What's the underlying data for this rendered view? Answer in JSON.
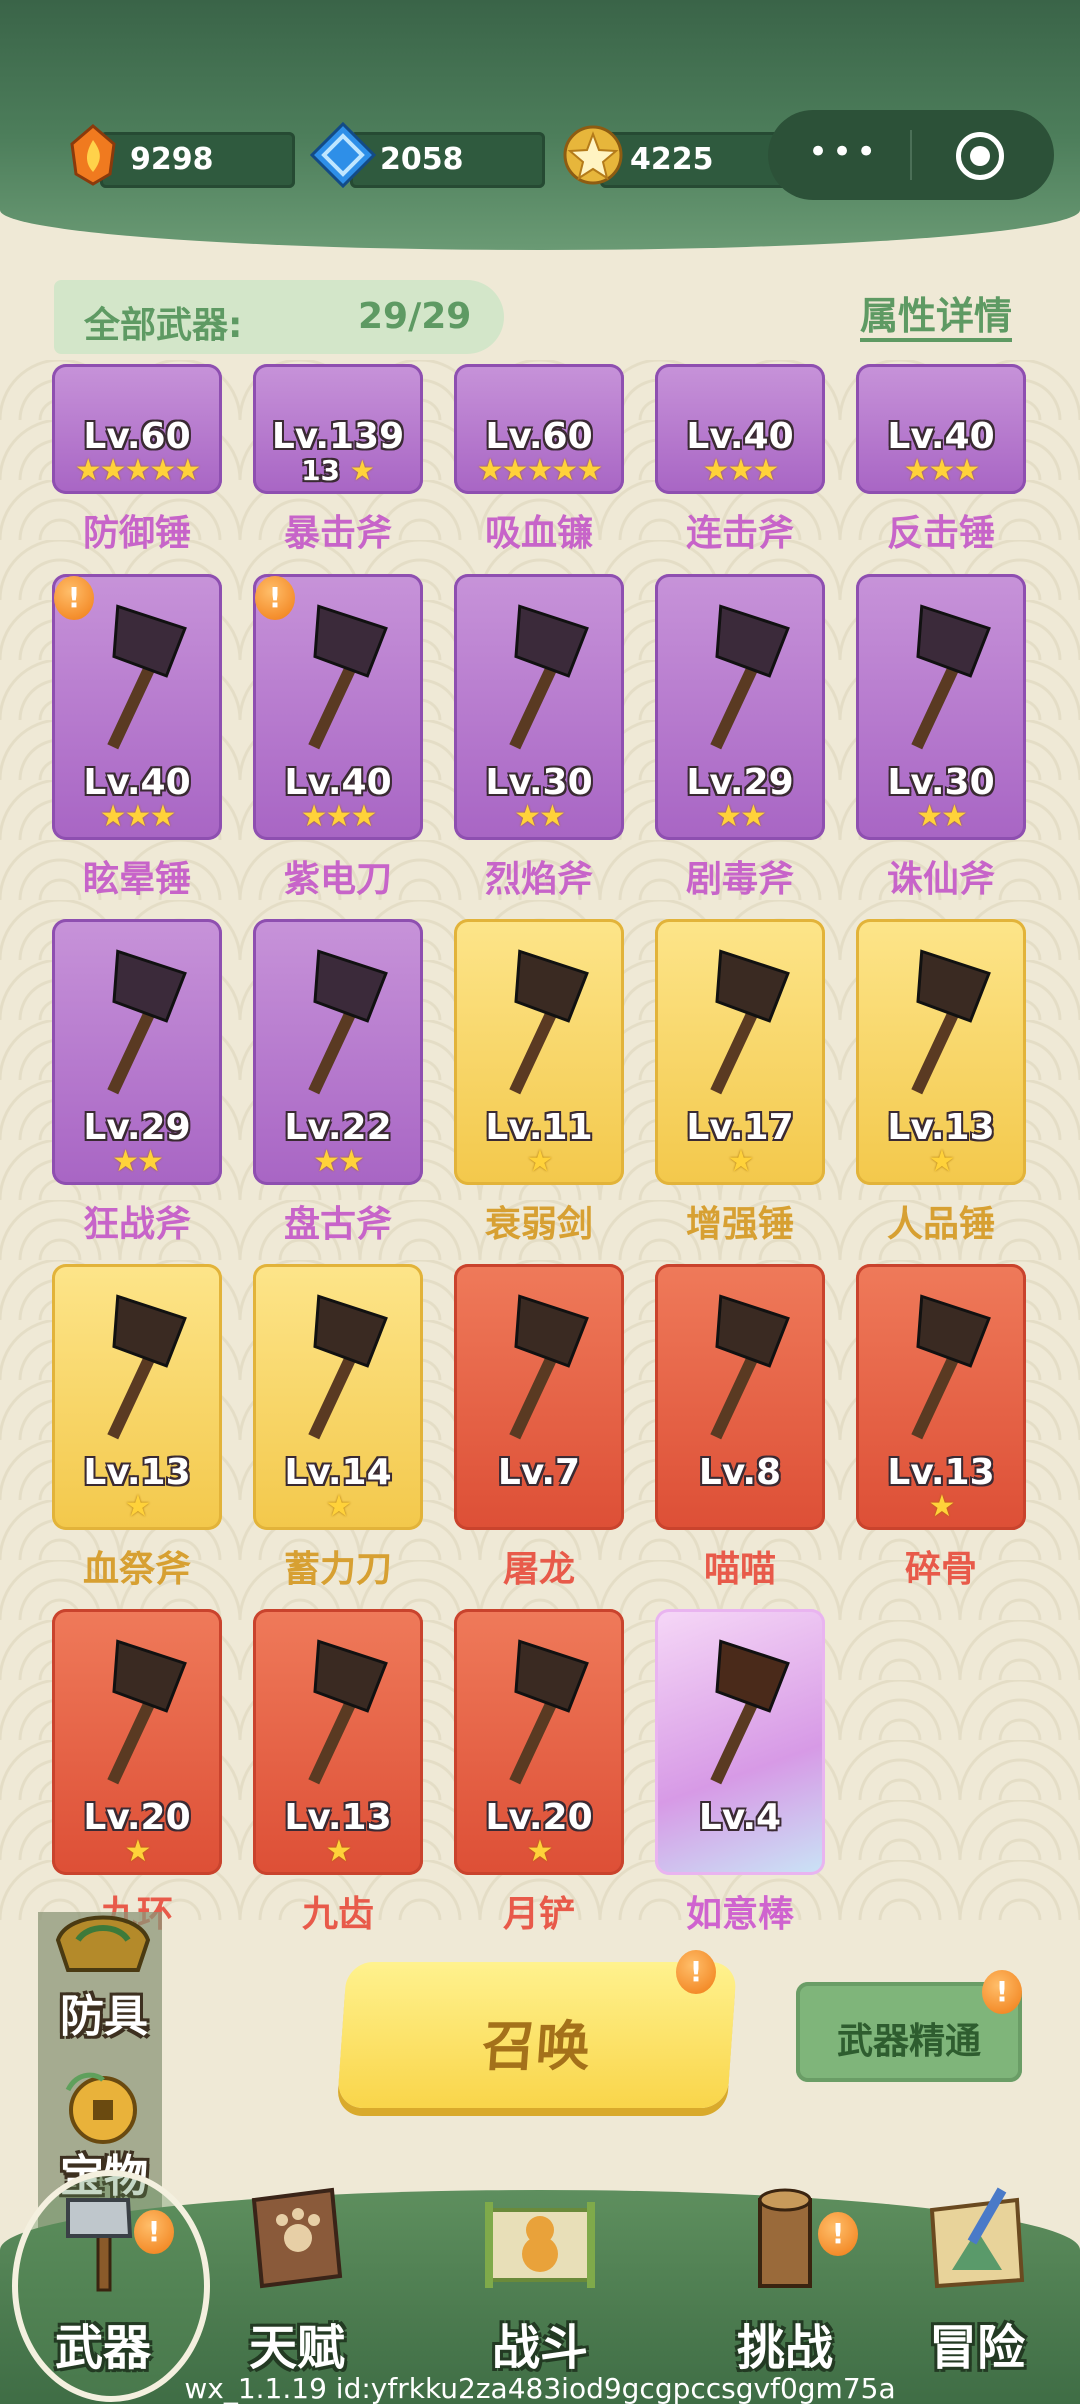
{
  "currencies": [
    {
      "name": "fire-crystal",
      "value": "9298",
      "color": "#f07a1f"
    },
    {
      "name": "blue-diamond",
      "value": "2058",
      "color": "#2e8fe8"
    },
    {
      "name": "star-medal",
      "value": "4225",
      "color": "#e7b63b"
    }
  ],
  "capsule": {
    "more": "•••"
  },
  "collection": {
    "label": "全部武器:",
    "count": "29/29",
    "details_link": "属性详情"
  },
  "weapons": [
    {
      "name": "防御锤",
      "level": "Lv.60",
      "stars": "★★★★★",
      "rarity": "purple",
      "star_text": ""
    },
    {
      "name": "暴击斧",
      "level": "Lv.139",
      "stars": "★",
      "rarity": "purple",
      "star_text": "13"
    },
    {
      "name": "吸血镰",
      "level": "Lv.60",
      "stars": "★★★★★",
      "rarity": "purple",
      "star_text": ""
    },
    {
      "name": "连击斧",
      "level": "Lv.40",
      "stars": "★★★",
      "rarity": "purple",
      "star_text": ""
    },
    {
      "name": "反击锤",
      "level": "Lv.40",
      "stars": "★★★",
      "rarity": "purple",
      "star_text": ""
    },
    {
      "name": "眩晕锤",
      "level": "Lv.40",
      "stars": "★★★",
      "rarity": "purple",
      "star_text": "",
      "alert": true
    },
    {
      "name": "紫电刀",
      "level": "Lv.40",
      "stars": "★★★",
      "rarity": "purple",
      "star_text": "",
      "alert": true
    },
    {
      "name": "烈焰斧",
      "level": "Lv.30",
      "stars": "★★",
      "rarity": "purple",
      "star_text": ""
    },
    {
      "name": "剧毒斧",
      "level": "Lv.29",
      "stars": "★★",
      "rarity": "purple",
      "star_text": ""
    },
    {
      "name": "诛仙斧",
      "level": "Lv.30",
      "stars": "★★",
      "rarity": "purple",
      "star_text": ""
    },
    {
      "name": "狂战斧",
      "level": "Lv.29",
      "stars": "★★",
      "rarity": "purple",
      "star_text": ""
    },
    {
      "name": "盘古斧",
      "level": "Lv.22",
      "stars": "★★",
      "rarity": "purple",
      "star_text": ""
    },
    {
      "name": "衰弱剑",
      "level": "Lv.11",
      "stars": "★",
      "rarity": "yellow",
      "star_text": ""
    },
    {
      "name": "增强锤",
      "level": "Lv.17",
      "stars": "★",
      "rarity": "yellow",
      "star_text": ""
    },
    {
      "name": "人品锤",
      "level": "Lv.13",
      "stars": "★",
      "rarity": "yellow",
      "star_text": ""
    },
    {
      "name": "血祭斧",
      "level": "Lv.13",
      "stars": "★",
      "rarity": "yellow",
      "star_text": ""
    },
    {
      "name": "蓄力刀",
      "level": "Lv.14",
      "stars": "★",
      "rarity": "yellow",
      "star_text": ""
    },
    {
      "name": "屠龙",
      "level": "Lv.7",
      "stars": "",
      "rarity": "red",
      "star_text": ""
    },
    {
      "name": "喵喵",
      "level": "Lv.8",
      "stars": "",
      "rarity": "red",
      "star_text": ""
    },
    {
      "name": "碎骨",
      "level": "Lv.13",
      "stars": "★",
      "rarity": "red",
      "star_text": ""
    },
    {
      "name": "九环",
      "level": "Lv.20",
      "stars": "★",
      "rarity": "red",
      "star_text": ""
    },
    {
      "name": "九齿",
      "level": "Lv.13",
      "stars": "★",
      "rarity": "red",
      "star_text": ""
    },
    {
      "name": "月铲",
      "level": "Lv.20",
      "stars": "★",
      "rarity": "red",
      "star_text": ""
    },
    {
      "name": "如意棒",
      "level": "Lv.4",
      "stars": "",
      "rarity": "pink",
      "star_text": ""
    }
  ],
  "side_buttons": [
    {
      "label": "防具",
      "icon": "armor-icon"
    },
    {
      "label": "宝物",
      "icon": "treasure-icon"
    }
  ],
  "actions": {
    "summon": "召唤",
    "mastery": "武器精通",
    "alert_mark": "!"
  },
  "nav": [
    {
      "label": "武器",
      "icon": "axe-icon",
      "active": true,
      "alert": true
    },
    {
      "label": "天赋",
      "icon": "book-icon",
      "active": false,
      "alert": false
    },
    {
      "label": "战斗",
      "icon": "scroll-icon",
      "active": false,
      "alert": false
    },
    {
      "label": "挑战",
      "icon": "stump-icon",
      "active": false,
      "alert": true
    },
    {
      "label": "冒险",
      "icon": "map-icon",
      "active": false,
      "alert": false
    }
  ],
  "footer": "wx_1.1.19 id:yfrkku2za483iod9gcgpccsgvf0gm75a"
}
